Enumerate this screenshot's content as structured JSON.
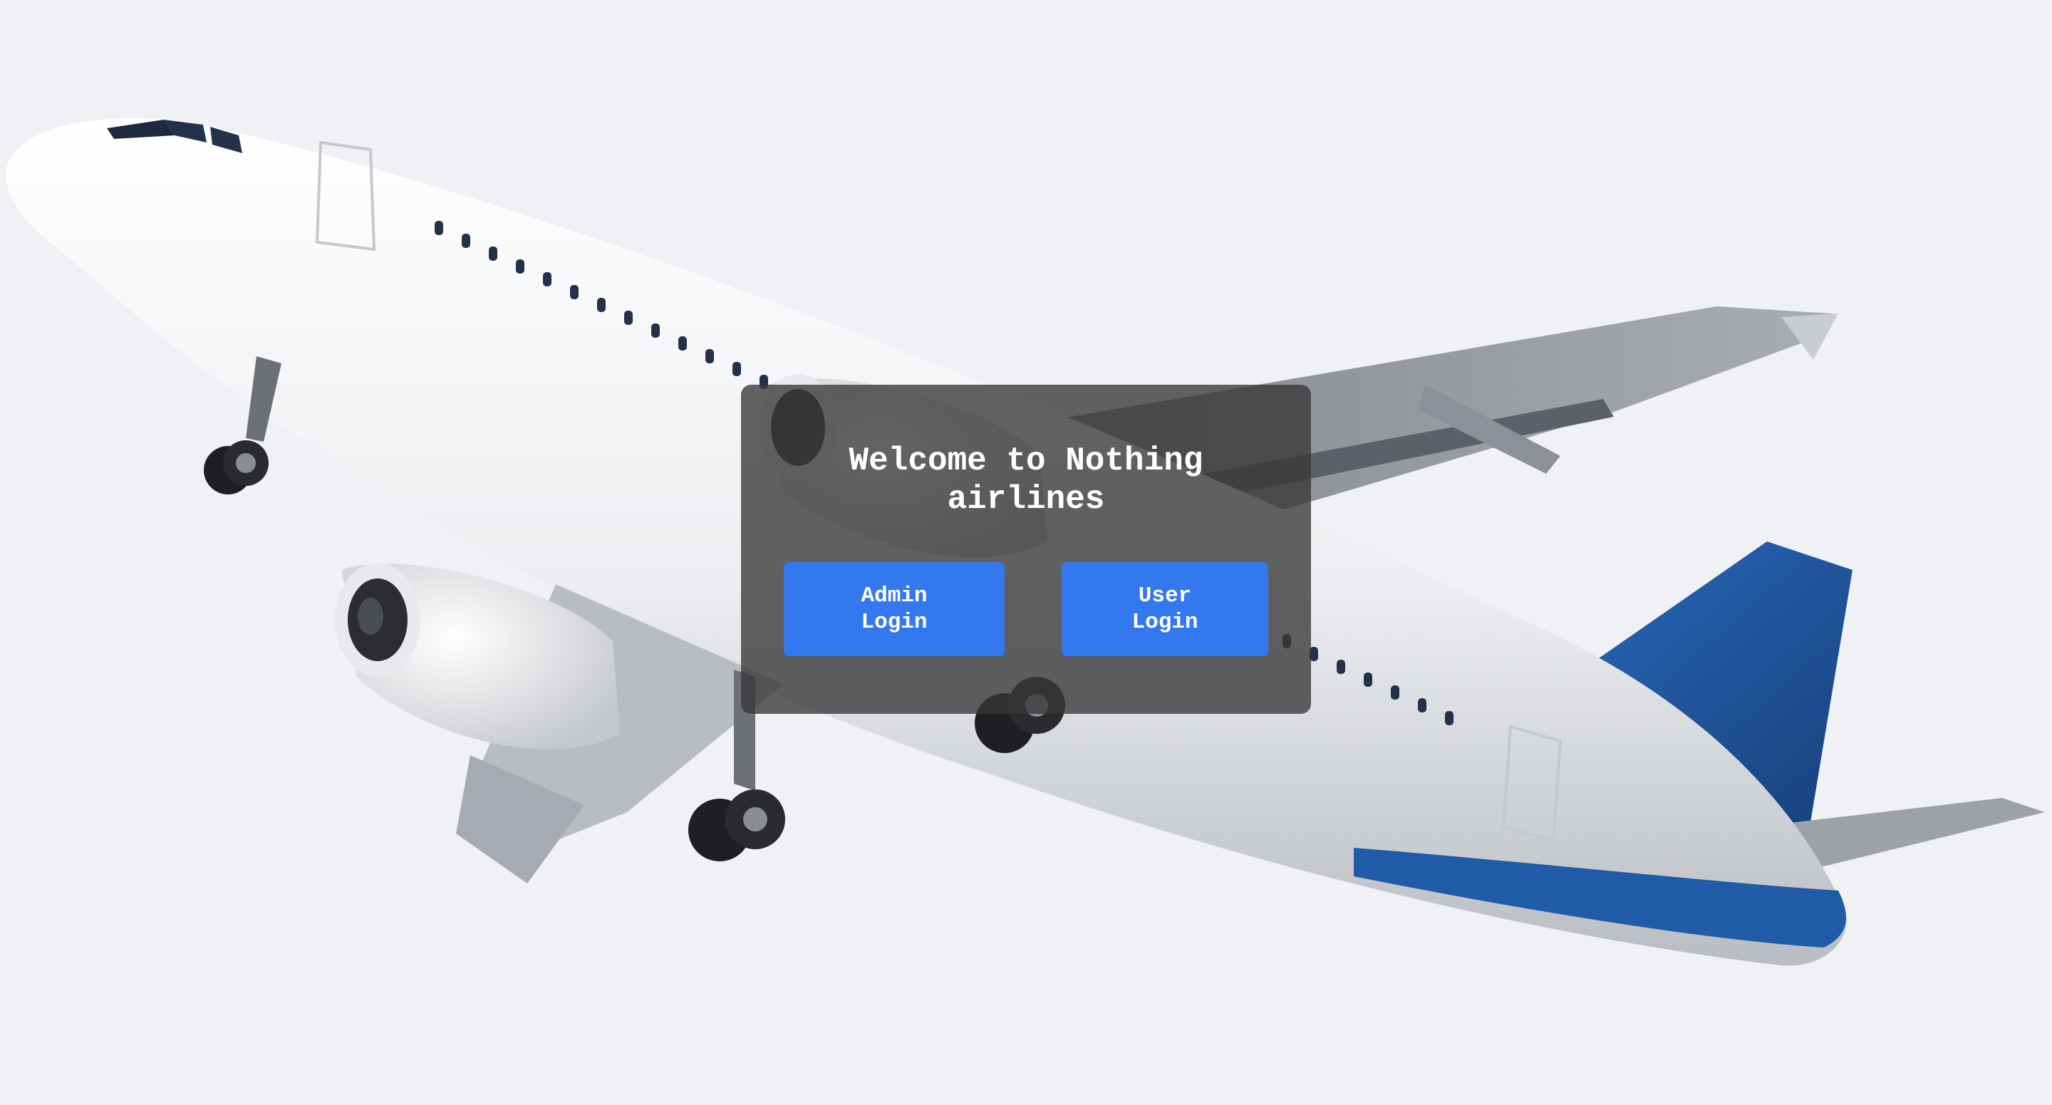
{
  "welcome": {
    "title": "Welcome to Nothing airlines",
    "admin_button_label": "Admin Login",
    "user_button_label": "User Login"
  },
  "colors": {
    "background": "#f0f1f4",
    "card": "#373737",
    "button": "#3478f0",
    "button_text": "#ffffff",
    "tail": "#1f5ba7"
  },
  "icons": {
    "background_image": "airplane-illustration"
  }
}
